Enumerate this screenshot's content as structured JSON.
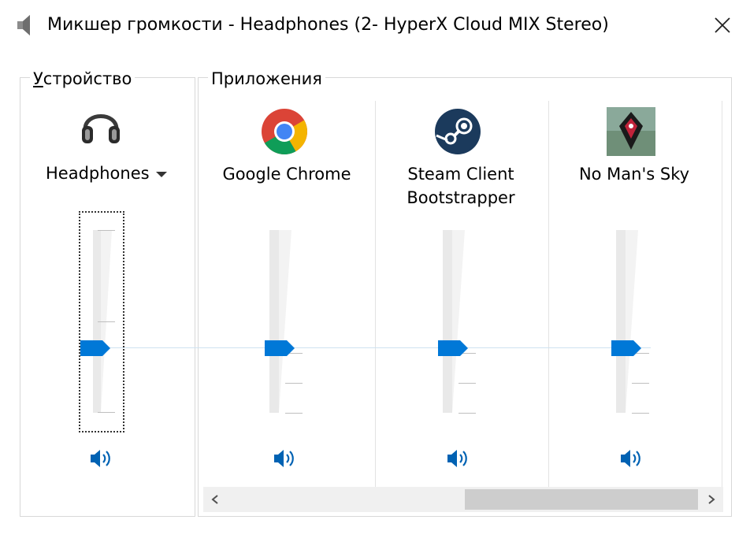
{
  "window": {
    "title": "Микшер громкости - Headphones (2- HyperX Cloud MIX Stereo)",
    "icons": {
      "title": "speaker-icon",
      "close": "close-icon"
    }
  },
  "device_group": {
    "label": "Устройство",
    "mnemonic": "У",
    "rest": "стройство",
    "device_name": "Headphones",
    "icon": "headphones-icon",
    "volume_fraction": 0.5
  },
  "apps_group": {
    "label": "Приложения",
    "apps": [
      {
        "name": "Google Chrome",
        "icon": "chrome-icon",
        "volume_fraction": 0.5
      },
      {
        "name_line1": "Steam Client",
        "name_line2": "Bootstrapper",
        "icon": "steam-icon",
        "volume_fraction": 0.5
      },
      {
        "name": "No Man's Sky",
        "icon": "no-mans-sky-icon",
        "volume_fraction": 0.5
      }
    ]
  },
  "colors": {
    "accent": "#0078d7",
    "slider_line": "#cfe2f0",
    "meter": "#e6e6e6"
  }
}
